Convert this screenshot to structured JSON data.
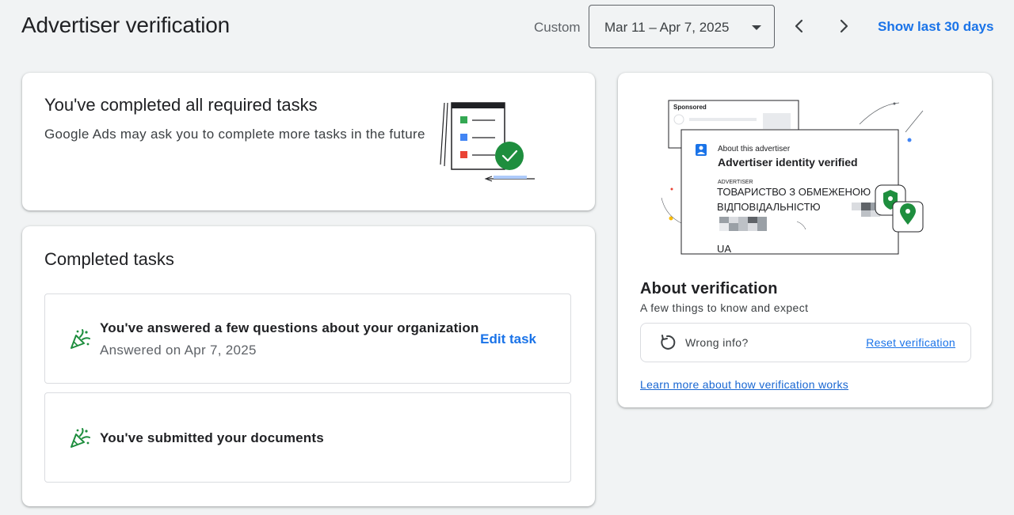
{
  "header": {
    "title": "Advertiser verification",
    "range_label": "Custom",
    "date_range": "Mar 11 – Apr 7, 2025",
    "show_last_label": "Show last 30 days",
    "prev_icon": "chevron-left-icon",
    "next_icon": "chevron-right-icon"
  },
  "status_card": {
    "title": "You've completed all required tasks",
    "subtitle": "Google Ads may ask you to complete more tasks in the future",
    "illustration": "checklist-complete-illustration"
  },
  "completed_tasks": {
    "title": "Completed tasks",
    "items": [
      {
        "title": "You've answered a few questions about your organization",
        "meta": "Answered on Apr 7, 2025",
        "action": "Edit task",
        "icon": "party-popper-icon"
      },
      {
        "title": "You've submitted your documents",
        "icon": "party-popper-icon"
      }
    ]
  },
  "about": {
    "illustration": {
      "sponsored_label": "Sponsored",
      "about_label": "About this advertiser",
      "verified_label": "Advertiser identity verified",
      "advertiser_label": "ADVERTISER",
      "advertiser_name_line1": "ТОВАРИСТВО З ОБМЕЖЕНОЮ",
      "advertiser_name_line2": "ВІДПОВІДАЛЬНІСТЮ",
      "country": "UA"
    },
    "title": "About verification",
    "subtitle": "A few things to know and expect",
    "wrong_info_label": "Wrong info?",
    "reset_label": "Reset verification",
    "learn_more_label": "Learn more about how verification works"
  },
  "colors": {
    "accent": "#1a73e8",
    "success": "#1e8e3e",
    "background": "#f1f3f4"
  }
}
